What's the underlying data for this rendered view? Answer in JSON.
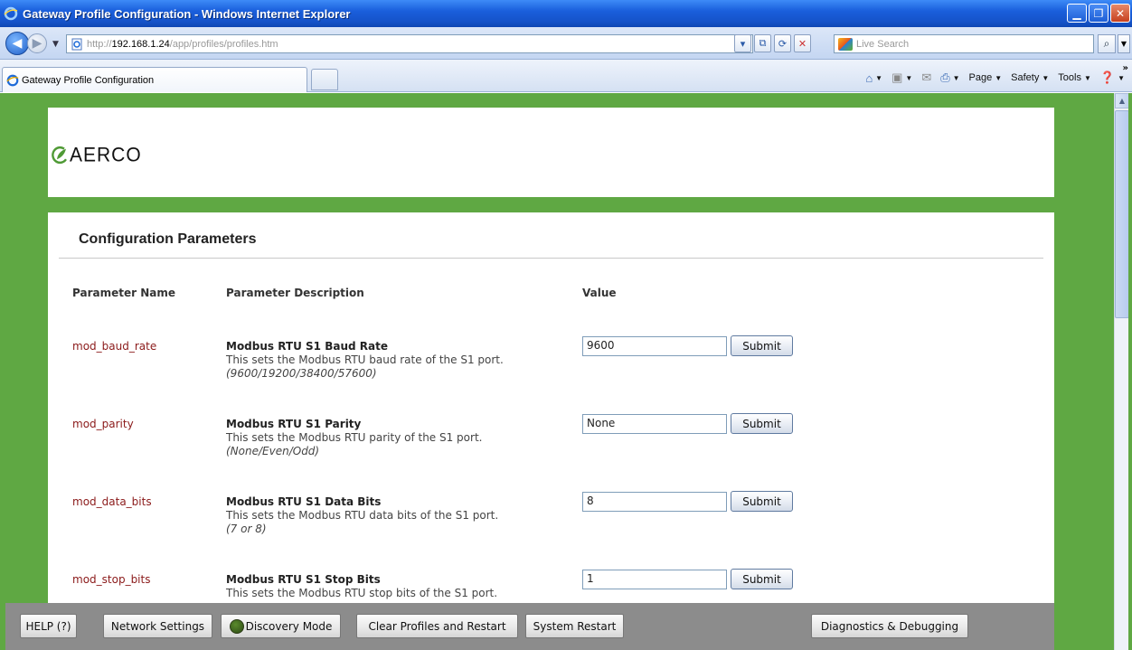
{
  "window": {
    "title": "Gateway Profile Configuration - Windows Internet Explorer",
    "controls": [
      "minimize",
      "maximize",
      "close"
    ]
  },
  "addressbar": {
    "url_prefix": "http://",
    "url_host": "192.168.1.24",
    "url_path": "/app/profiles/profiles.htm",
    "search_placeholder": "Live Search"
  },
  "tabbar": {
    "active_tab": "Gateway Profile Configuration",
    "commands": {
      "page": "Page",
      "safety": "Safety",
      "tools": "Tools",
      "more": "»"
    }
  },
  "logo": {
    "text": "AERCO"
  },
  "config": {
    "title": "Configuration Parameters",
    "headers": {
      "name": "Parameter Name",
      "description": "Parameter Description",
      "value": "Value"
    },
    "submit_label": "Submit",
    "rows": [
      {
        "name": "mod_baud_rate",
        "title": "Modbus RTU S1 Baud Rate",
        "desc": "This sets the Modbus RTU baud rate of the S1 port.",
        "range": "(9600/19200/38400/57600)",
        "value": "9600"
      },
      {
        "name": "mod_parity",
        "title": "Modbus RTU S1 Parity",
        "desc": "This sets the Modbus RTU parity of the S1 port.",
        "range": "(None/Even/Odd)",
        "value": "None"
      },
      {
        "name": "mod_data_bits",
        "title": "Modbus RTU S1 Data Bits",
        "desc": "This sets the Modbus RTU data bits of the S1 port.",
        "range": "(7 or 8)",
        "value": "8"
      },
      {
        "name": "mod_stop_bits",
        "title": "Modbus RTU S1 Stop Bits",
        "desc": "This sets the Modbus RTU stop bits of the S1 port.",
        "range": "",
        "value": "1"
      }
    ]
  },
  "bottombar": {
    "help": "HELP (?)",
    "network": "Network Settings",
    "discovery": "Discovery Mode",
    "clear": "Clear Profiles and Restart",
    "restart": "System Restart",
    "diagnostics": "Diagnostics & Debugging"
  },
  "colors": {
    "page_green": "#5fa843",
    "param_name": "#8b1a1a",
    "titlebar_blue": "#1a5fdc",
    "bottombar_gray": "#8c8c8c"
  }
}
